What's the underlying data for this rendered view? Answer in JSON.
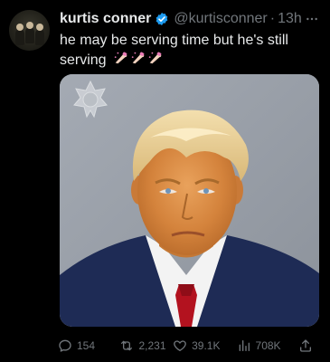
{
  "tweet": {
    "display_name": "kurtis conner",
    "handle": "@kurtisconner",
    "separator": "·",
    "time": "13h",
    "more_icon": "more-dots-icon",
    "verified_icon": "verified-badge-icon",
    "text": "he may be serving time but he's still serving",
    "emoji": [
      "nail-polish-emoji",
      "nail-polish-emoji",
      "nail-polish-emoji"
    ],
    "media_alt": "mugshot photo with sheriff badge watermark"
  },
  "actions": {
    "replies": "154",
    "retweets": "2,231",
    "likes": "39.1K",
    "views": "708K"
  },
  "colors": {
    "background": "#000000",
    "text": "#e7e9ea",
    "muted": "#71767b",
    "verified": "#1d9bf0"
  }
}
